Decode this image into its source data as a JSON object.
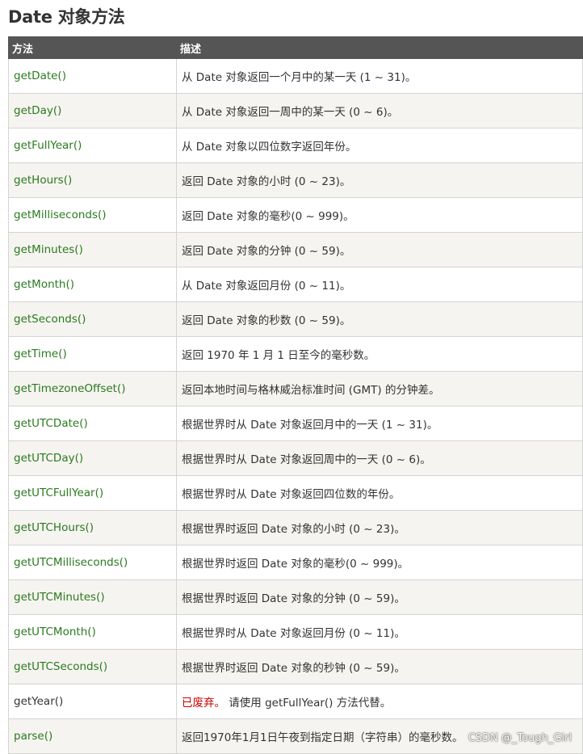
{
  "title": "Date 对象方法",
  "table": {
    "headers": [
      "方法",
      "描述"
    ],
    "rows": [
      {
        "method": "getDate()",
        "desc": "从 Date 对象返回一个月中的某一天 (1 ~ 31)。"
      },
      {
        "method": "getDay()",
        "desc": "从 Date 对象返回一周中的某一天 (0 ~ 6)。"
      },
      {
        "method": "getFullYear()",
        "desc": "从 Date 对象以四位数字返回年份。"
      },
      {
        "method": "getHours()",
        "desc": "返回 Date 对象的小时 (0 ~ 23)。"
      },
      {
        "method": "getMilliseconds()",
        "desc": "返回 Date 对象的毫秒(0 ~ 999)。"
      },
      {
        "method": "getMinutes()",
        "desc": "返回 Date 对象的分钟 (0 ~ 59)。"
      },
      {
        "method": "getMonth()",
        "desc": "从 Date 对象返回月份 (0 ~ 11)。"
      },
      {
        "method": "getSeconds()",
        "desc": "返回 Date 对象的秒数 (0 ~ 59)。"
      },
      {
        "method": "getTime()",
        "desc": "返回 1970 年 1 月 1 日至今的毫秒数。"
      },
      {
        "method": "getTimezoneOffset()",
        "desc": "返回本地时间与格林威治标准时间 (GMT) 的分钟差。"
      },
      {
        "method": "getUTCDate()",
        "desc": "根据世界时从 Date 对象返回月中的一天 (1 ~ 31)。"
      },
      {
        "method": "getUTCDay()",
        "desc": "根据世界时从 Date 对象返回周中的一天 (0 ~ 6)。"
      },
      {
        "method": "getUTCFullYear()",
        "desc": "根据世界时从 Date 对象返回四位数的年份。"
      },
      {
        "method": "getUTCHours()",
        "desc": "根据世界时返回 Date 对象的小时 (0 ~ 23)。"
      },
      {
        "method": "getUTCMilliseconds()",
        "desc": "根据世界时返回 Date 对象的毫秒(0 ~ 999)。"
      },
      {
        "method": "getUTCMinutes()",
        "desc": "根据世界时返回 Date 对象的分钟 (0 ~ 59)。"
      },
      {
        "method": "getUTCMonth()",
        "desc": "根据世界时从 Date 对象返回月份 (0 ~ 11)。"
      },
      {
        "method": "getUTCSeconds()",
        "desc": "根据世界时返回 Date 对象的秒钟 (0 ~ 59)。"
      },
      {
        "method": "getYear()",
        "desc_deprecated": "已废弃。",
        "desc": " 请使用 getFullYear() 方法代替。"
      },
      {
        "method": "parse()",
        "desc": "返回1970年1月1日午夜到指定日期（字符串）的毫秒数。"
      }
    ]
  },
  "watermark": "CSDN @_Tough_Girl",
  "colors": {
    "header_bg": "#555555",
    "method_link": "#2a7a1f",
    "deprecated": "#cc0000",
    "row_alt_bg": "#f6f4f0"
  }
}
